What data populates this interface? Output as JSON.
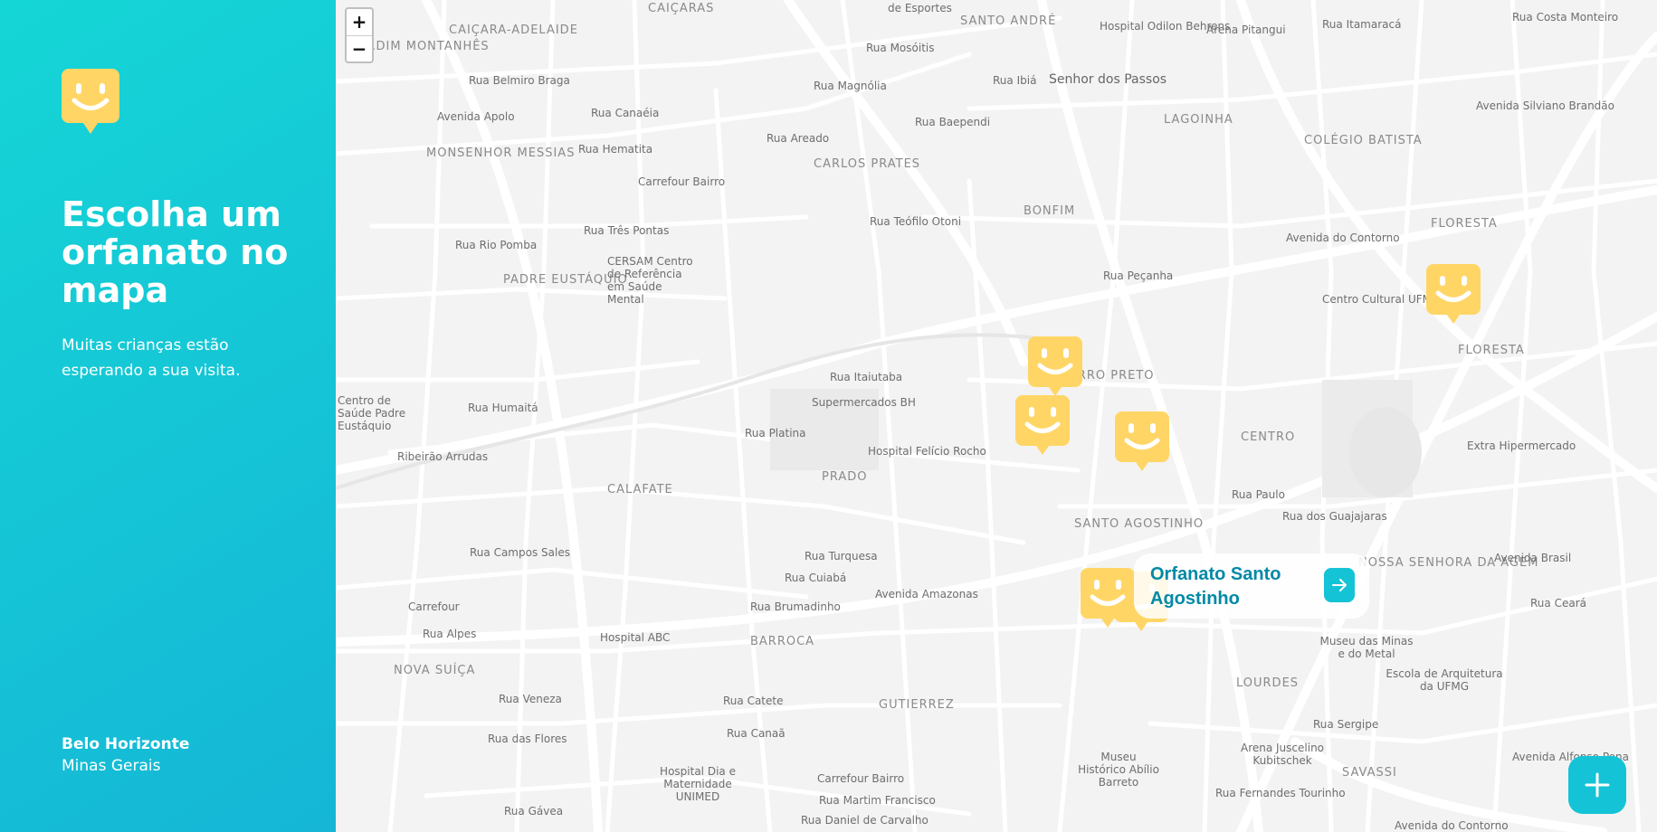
{
  "sidebar": {
    "title": "Escolha um orfanato no mapa",
    "description": "Muitas crianças estão esperando a sua visita.",
    "city": "Belo Horizonte",
    "state": "Minas Gerais"
  },
  "map": {
    "zoom_in_label": "+",
    "zoom_out_label": "−",
    "districts": [
      "JARDIM MONTANHÊS",
      "CAIÇARA-ADELAIDE",
      "CAIÇARAS",
      "SANTO ANDRÉ",
      "Senhor dos Passos",
      "LAGOINHA",
      "COLÉGIO BATISTA",
      "MONSENHOR MESSIAS",
      "CARLOS PRATES",
      "BONFIM",
      "FLORESTA",
      "PADRE EUSTÁQUIO",
      "FLORESTA",
      "BARRO PRETO",
      "CENTRO",
      "CALAFATE",
      "PRADO",
      "SANTO AGOSTINHO",
      "NOSSA SENHORA DA AGEM",
      "BARROCA",
      "NOVA SUÍÇA",
      "LOURDES",
      "GUTIERREZ",
      "SAVASSI"
    ],
    "labels": [
      "de Esportes",
      "Hospital Odilon Behrens",
      "Arena Pitangui",
      "Rua Itamaracá",
      "Rua Costa Monteiro",
      "Rua Belmiro Braga",
      "Rua Magnólia",
      "Rua Mosóitis",
      "Rua Ibiá",
      "Avenida Apolo",
      "Rua Canaéia",
      "Rua Hematita",
      "Rua Areado",
      "Rua Baependi",
      "Carrefour Bairro",
      "Rua Três Pontas",
      "Rua Teófilo Otoni",
      "Avenida do Contorno",
      "Centro Cultural UFMG",
      "Rua Rio Pomba",
      "CERSAM Centro de Referência em Saúde Mental",
      "Rua Peçanha",
      "Rua Itaiutaba",
      "Supermercados BH",
      "Centro de Saúde Padre Eustáquio",
      "Rua Humaitá",
      "Rua Platina",
      "Hospital Felício Rocho",
      "Ribeirão Arrudas",
      "Extra Hipermercado",
      "Rua dos Guajajaras",
      "Rua Campos Sales",
      "Rua Turquesa",
      "Rua Cuiabá",
      "Avenida Amazonas",
      "Carrefour",
      "Rua Alpes",
      "Hospital ABC",
      "Rua Brumadinho",
      "Museu das Minas e do Metal",
      "Escola de Arquitetura da UFMG",
      "Avenida Brasil",
      "Rua Veneza",
      "Rua Catete",
      "Rua das Flores",
      "Rua Canaã",
      "Hospital Dia e Maternidade UNIMED",
      "Carrefour Bairro",
      "Rua Martim Francisco",
      "Museu Histórico Abílio Barreto",
      "Arena Juscelino Kubitschek",
      "Rua Fernandes Tourinho",
      "Rua Gávea",
      "Rua Daniel de Carvalho",
      "Avenida do Contorno",
      "Avenida Silviano Brandão",
      "Rua Ceará",
      "Rua Paulo",
      "Avenida Alfonso Pena",
      "Rua Sergipe"
    ],
    "popup": {
      "name": "Orfanato Santo Agostinho"
    },
    "marker_icon": "happy-face-map-marker-icon",
    "accent_color": "#15c3d6",
    "marker_color": "#ffd666",
    "popup_text_color": "#0089a5"
  }
}
